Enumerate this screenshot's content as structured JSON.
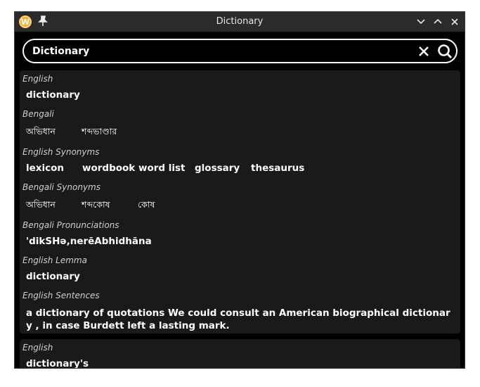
{
  "window": {
    "title": "Dictionary"
  },
  "search": {
    "query": "Dictionary"
  },
  "entry1": {
    "english_label": "English",
    "english_word": "dictionary",
    "bengali_label": "Bengali",
    "bengali_words": [
      "অভিধান",
      "শব্দভাণ্ডার"
    ],
    "english_synonyms_label": "English Synonyms",
    "english_synonyms": [
      "lexicon",
      "wordbook",
      "word list",
      "glossary",
      "thesaurus"
    ],
    "bengali_synonyms_label": "Bengali Synonyms",
    "bengali_synonyms": [
      "অভিধান",
      "শব্দকোষ",
      "কোষ"
    ],
    "pronunciations_label": "Bengali Pronunciations",
    "pronunciation": "'dikSHə,nerēAbhidhāna",
    "lemma_label": "English Lemma",
    "lemma": "dictionary",
    "sentences_label": "English Sentences",
    "sentence": "a dictionary of quotations We could consult an American biographical dictionary , in case Burdett left a lasting mark."
  },
  "entry2": {
    "english_label": "English",
    "english_word": "dictionary's"
  },
  "icons": {
    "app": "app-logo-icon",
    "pin": "pin-icon",
    "minimize": "chevron-down-icon",
    "maximize": "chevron-up-icon",
    "close": "close-icon",
    "clear": "clear-x-icon",
    "search": "search-icon"
  }
}
